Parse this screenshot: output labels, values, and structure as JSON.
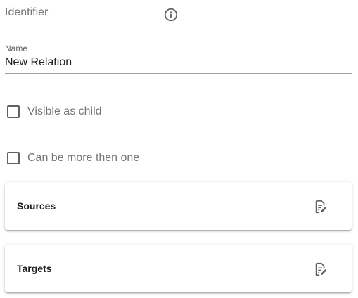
{
  "identifier": {
    "placeholder": "Identifier",
    "value": "",
    "info_icon": "info-circle-icon"
  },
  "name": {
    "label": "Name",
    "value": "New Relation"
  },
  "checkboxes": [
    {
      "label": "Visible as child",
      "checked": false
    },
    {
      "label": "Can be more then one",
      "checked": false
    }
  ],
  "cards": [
    {
      "title": "Sources",
      "icon": "edit-document-icon"
    },
    {
      "title": "Targets",
      "icon": "edit-document-icon"
    }
  ],
  "colors": {
    "text": "#212121",
    "muted": "#757575",
    "underline": "#9e9e9e",
    "icon": "#616161"
  }
}
